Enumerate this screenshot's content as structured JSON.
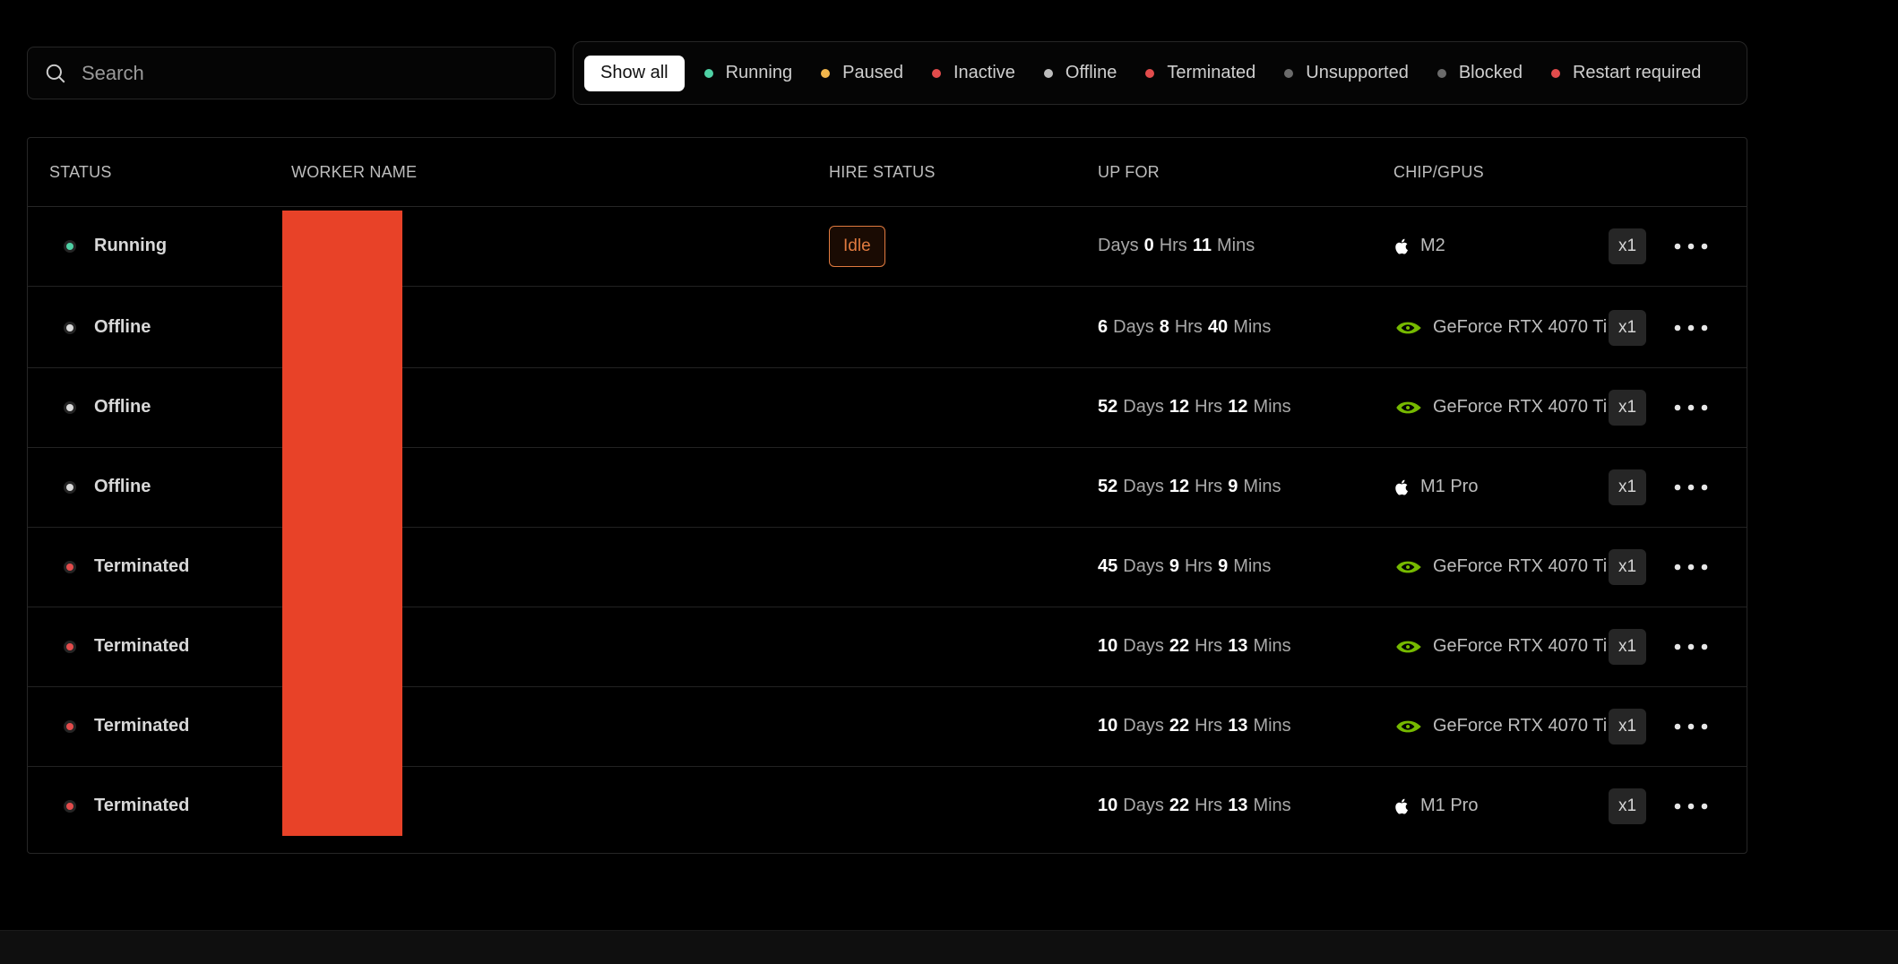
{
  "search": {
    "placeholder": "Search",
    "value": ""
  },
  "filters": {
    "show_all": "Show all",
    "items": [
      {
        "label": "Running",
        "color": "#4fd1a5"
      },
      {
        "label": "Paused",
        "color": "#f2b64c"
      },
      {
        "label": "Inactive",
        "color": "#e24c4c"
      },
      {
        "label": "Offline",
        "color": "#bdbdbd"
      },
      {
        "label": "Terminated",
        "color": "#e24c4c"
      },
      {
        "label": "Unsupported",
        "color": "#6b6b6b"
      },
      {
        "label": "Blocked",
        "color": "#6b6b6b"
      },
      {
        "label": "Restart required",
        "color": "#e24c4c"
      }
    ]
  },
  "table": {
    "headers": {
      "status": "STATUS",
      "worker_name": "WORKER NAME",
      "hire_status": "HIRE STATUS",
      "up_for": "UP FOR",
      "chip": "CHIP/GPUS"
    },
    "rows": [
      {
        "status": "Running",
        "status_color": "#4fd1a5",
        "hire": "Idle",
        "uptime": {
          "days": "",
          "hrs": "0",
          "mins": "11"
        },
        "chip_icon": "apple-icon",
        "chip": "M2",
        "count": "x1"
      },
      {
        "status": "Offline",
        "status_color": "#d9d9d9",
        "hire": "",
        "uptime": {
          "days": "6",
          "hrs": "8",
          "mins": "40"
        },
        "chip_icon": "nvidia-icon",
        "chip": "GeForce RTX 4070 Ti",
        "count": "x1"
      },
      {
        "status": "Offline",
        "status_color": "#d9d9d9",
        "hire": "",
        "uptime": {
          "days": "52",
          "hrs": "12",
          "mins": "12"
        },
        "chip_icon": "nvidia-icon",
        "chip": "GeForce RTX 4070 Ti",
        "count": "x1"
      },
      {
        "status": "Offline",
        "status_color": "#d9d9d9",
        "hire": "",
        "uptime": {
          "days": "52",
          "hrs": "12",
          "mins": "9"
        },
        "chip_icon": "apple-icon",
        "chip": "M1 Pro",
        "count": "x1"
      },
      {
        "status": "Terminated",
        "status_color": "#e24c4c",
        "hire": "",
        "uptime": {
          "days": "45",
          "hrs": "9",
          "mins": "9"
        },
        "chip_icon": "nvidia-icon",
        "chip": "GeForce RTX 4070 Ti",
        "count": "x1"
      },
      {
        "status": "Terminated",
        "status_color": "#e24c4c",
        "hire": "",
        "uptime": {
          "days": "10",
          "hrs": "22",
          "mins": "13"
        },
        "chip_icon": "nvidia-icon",
        "chip": "GeForce RTX 4070 Ti",
        "count": "x1"
      },
      {
        "status": "Terminated",
        "status_color": "#e24c4c",
        "hire": "",
        "uptime": {
          "days": "10",
          "hrs": "22",
          "mins": "13"
        },
        "chip_icon": "nvidia-icon",
        "chip": "GeForce RTX 4070 Ti",
        "count": "x1"
      },
      {
        "status": "Terminated",
        "status_color": "#e24c4c",
        "hire": "",
        "uptime": {
          "days": "10",
          "hrs": "22",
          "mins": "13"
        },
        "chip_icon": "apple-icon",
        "chip": "M1 Pro",
        "count": "x1"
      }
    ],
    "uptime_units": {
      "days": "Days",
      "hrs": "Hrs",
      "mins": "Mins"
    }
  },
  "colors": {
    "accent_idle": "#e07a3f",
    "redaction": "#e84228",
    "nvidia_green": "#76b900"
  }
}
